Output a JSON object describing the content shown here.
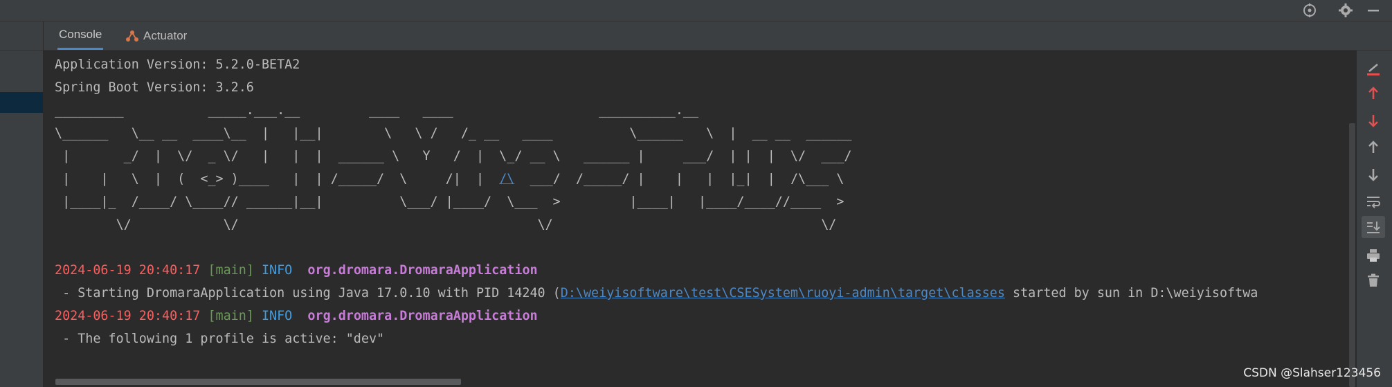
{
  "tabs": [
    {
      "label": "Console",
      "active": true
    },
    {
      "label": "Actuator",
      "icon": "actuator-icon"
    }
  ],
  "console": {
    "app_version": "Application Version: 5.2.0-BETA2",
    "boot_version": "Spring Boot Version: 3.2.6",
    "banner": [
      "_________           _____.___.__         ____   ____                   __________.__",
      "\\______   \\__ __  ____\\__  |   |__|        \\   \\ /   /_ __   ____          \\______   \\  |  __ __  ______",
      " |       _/  |  \\/  _ \\/   |   |  |  ______ \\   Y   /  |  \\_/ __ \\   ______ |     ___/  | |  |  \\/  ___/",
      " |    |   \\  |  (  <_> )____   |  | /_____/  \\     /|  |  ",
      " |____|_  /____/ \\____// ______|__|          \\___/ |____/  \\___  >         |____|   |____/____//____  >",
      "        \\/            \\/                                       \\/                                   \\/"
    ],
    "banner_row4_link": "/\\",
    "banner_row4_tail": "  ___/  /_____/ |    |   |  |_|  |  /\\___ \\",
    "logs": [
      {
        "timestamp": "2024-06-19 20:40:17",
        "thread": "[main]",
        "level": "INFO",
        "logger": "org.dromara.DromaraApplication",
        "message_prefix": " - Starting DromaraApplication using Java 17.0.10 with PID 14240 (",
        "message_link": "D:\\weiyisoftware\\test\\CSESystem\\ruoyi-admin\\target\\classes",
        "message_suffix": " started by sun in D:\\weiyisoftwa"
      },
      {
        "timestamp": "2024-06-19 20:40:17",
        "thread": "[main]",
        "level": "INFO",
        "logger": "org.dromara.DromaraApplication",
        "message": " - The following 1 profile is active: \"dev\""
      }
    ]
  },
  "watermark": "CSDN @Slahser123456",
  "colors": {
    "timestamp": "#ff5c5c",
    "thread": "#6a9955",
    "level": "#3d9ee6",
    "logger": "#c77dd7",
    "link": "#4a88c7"
  }
}
